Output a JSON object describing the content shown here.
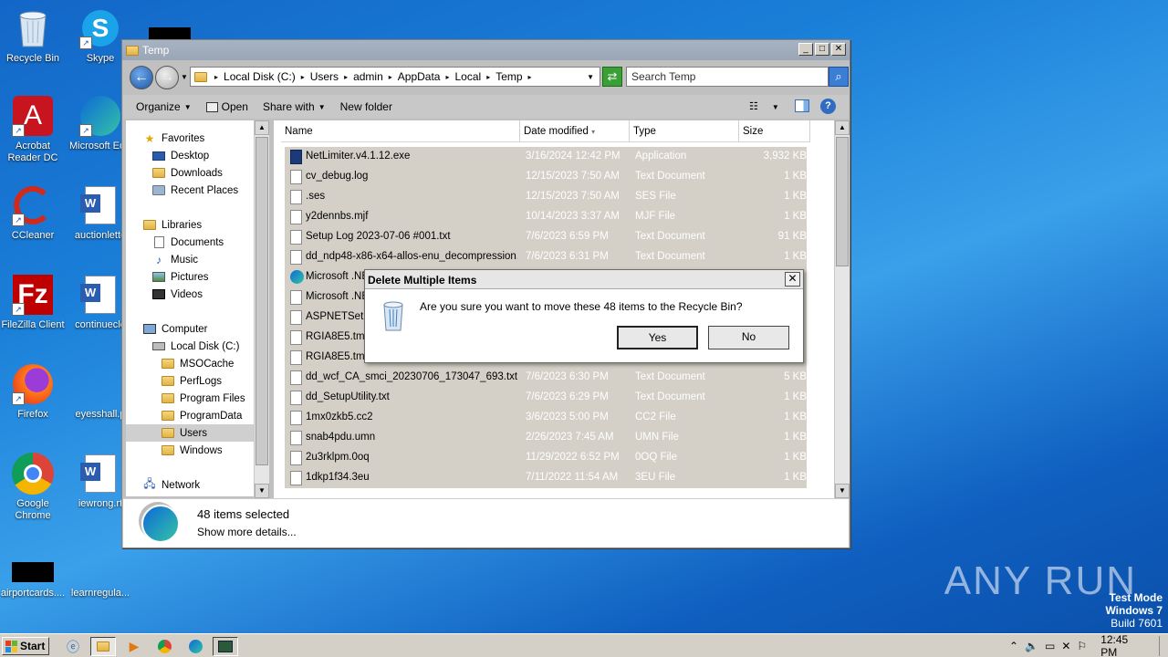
{
  "desktop": {
    "icons": [
      {
        "label": "Recycle Bin"
      },
      {
        "label": "Skype"
      },
      {
        "label": "Acrobat Reader DC"
      },
      {
        "label": "Microsoft Ed"
      },
      {
        "label": "CCleaner"
      },
      {
        "label": "auctionlette"
      },
      {
        "label": "FileZilla Client"
      },
      {
        "label": "continuecle"
      },
      {
        "label": "Firefox"
      },
      {
        "label": "eyesshall.p"
      },
      {
        "label": "Google Chrome"
      },
      {
        "label": "iewrong.rt"
      },
      {
        "label": "airportcards...."
      },
      {
        "label": "learnregula..."
      }
    ]
  },
  "window": {
    "title": "Temp",
    "breadcrumb": [
      "Local Disk (C:)",
      "Users",
      "admin",
      "AppData",
      "Local",
      "Temp"
    ],
    "search_placeholder": "Search Temp",
    "toolbar": {
      "organize": "Organize",
      "open": "Open",
      "share_with": "Share with",
      "new_folder": "New folder"
    },
    "nav": [
      {
        "label": "Favorites"
      },
      {
        "label": "Desktop"
      },
      {
        "label": "Downloads"
      },
      {
        "label": "Recent Places"
      },
      {
        "label": "Libraries"
      },
      {
        "label": "Documents"
      },
      {
        "label": "Music"
      },
      {
        "label": "Pictures"
      },
      {
        "label": "Videos"
      },
      {
        "label": "Computer"
      },
      {
        "label": "Local Disk (C:)"
      },
      {
        "label": "MSOCache"
      },
      {
        "label": "PerfLogs"
      },
      {
        "label": "Program Files"
      },
      {
        "label": "ProgramData"
      },
      {
        "label": "Users"
      },
      {
        "label": "Windows"
      },
      {
        "label": "Network"
      }
    ],
    "columns": [
      "Name",
      "Date modified",
      "Type",
      "Size"
    ],
    "files": [
      {
        "name": "NetLimiter.v4.1.12.exe",
        "date": "3/16/2024 12:42 PM",
        "type": "Application",
        "size": "3,932 KB",
        "icon": "exe"
      },
      {
        "name": "cv_debug.log",
        "date": "12/15/2023 7:50 AM",
        "type": "Text Document",
        "size": "1 KB",
        "icon": "doc"
      },
      {
        "name": ".ses",
        "date": "12/15/2023 7:50 AM",
        "type": "SES File",
        "size": "1 KB",
        "icon": "doc"
      },
      {
        "name": "y2dennbs.mjf",
        "date": "10/14/2023 3:37 AM",
        "type": "MJF File",
        "size": "1 KB",
        "icon": "doc"
      },
      {
        "name": "Setup Log 2023-07-06 #001.txt",
        "date": "7/6/2023 6:59 PM",
        "type": "Text Document",
        "size": "91 KB",
        "icon": "doc"
      },
      {
        "name": "dd_ndp48-x86-x64-allos-enu_decompression...",
        "date": "7/6/2023 6:31 PM",
        "type": "Text Document",
        "size": "1 KB",
        "icon": "doc"
      },
      {
        "name": "Microsoft .NE",
        "date": "",
        "type": "",
        "size": "",
        "icon": "edge"
      },
      {
        "name": "Microsoft .NE",
        "date": "",
        "type": "",
        "size": "",
        "icon": "doc"
      },
      {
        "name": "ASPNETSetup",
        "date": "",
        "type": "",
        "size": "",
        "icon": "doc"
      },
      {
        "name": "RGIA8E5.tmp",
        "date": "",
        "type": "",
        "size": "",
        "icon": "doc"
      },
      {
        "name": "RGIA8E5.tmp",
        "date": "",
        "type": "",
        "size": "",
        "icon": "doc"
      },
      {
        "name": "dd_wcf_CA_smci_20230706_173047_693.txt",
        "date": "7/6/2023 6:30 PM",
        "type": "Text Document",
        "size": "5 KB",
        "icon": "doc"
      },
      {
        "name": "dd_SetupUtility.txt",
        "date": "7/6/2023 6:29 PM",
        "type": "Text Document",
        "size": "1 KB",
        "icon": "doc"
      },
      {
        "name": "1mx0zkb5.cc2",
        "date": "3/6/2023 5:00 PM",
        "type": "CC2 File",
        "size": "1 KB",
        "icon": "doc"
      },
      {
        "name": "snab4pdu.umn",
        "date": "2/26/2023 7:45 AM",
        "type": "UMN File",
        "size": "1 KB",
        "icon": "doc"
      },
      {
        "name": "2u3rklpm.0oq",
        "date": "11/29/2022 6:52 PM",
        "type": "0OQ File",
        "size": "1 KB",
        "icon": "doc"
      },
      {
        "name": "1dkp1f34.3eu",
        "date": "7/11/2022 11:54 AM",
        "type": "3EU File",
        "size": "1 KB",
        "icon": "doc"
      }
    ],
    "details": {
      "selected": "48 items selected",
      "more": "Show more details..."
    }
  },
  "dialog": {
    "title": "Delete Multiple Items",
    "message": "Are you sure you want to move these 48 items to the Recycle Bin?",
    "yes": "Yes",
    "no": "No",
    "close": "✕"
  },
  "taskbar": {
    "start": "Start",
    "clock": "12:45 PM"
  },
  "watermark": "ANY RUN",
  "testmode": {
    "line1": "Test Mode",
    "line2": "Windows 7",
    "line3": "Build 7601"
  },
  "colors": {
    "selection": "#d4d0c8",
    "desktop": "#1a7fd8"
  }
}
